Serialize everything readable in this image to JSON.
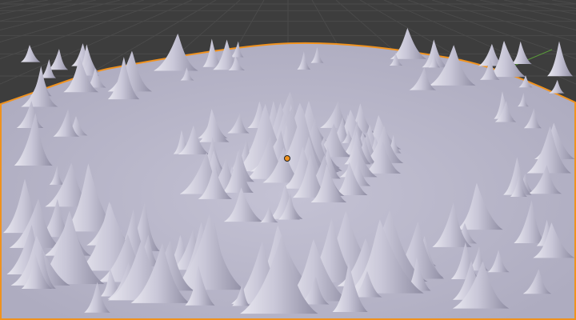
{
  "viewport": {
    "kind": "3d-viewport",
    "object": "terrain-mesh",
    "selected": true,
    "colors": {
      "background": "#3d3d3d",
      "grid": "#4a4a4a",
      "mesh": "#b9b7c9",
      "mesh_shadow": "#8f8da3",
      "mesh_highlight": "#eeeef2",
      "selection_outline": "#f0921e",
      "origin": "#f0921e",
      "axis_y": "#5a9a3a"
    },
    "icons": [
      "object-origin-icon"
    ]
  }
}
